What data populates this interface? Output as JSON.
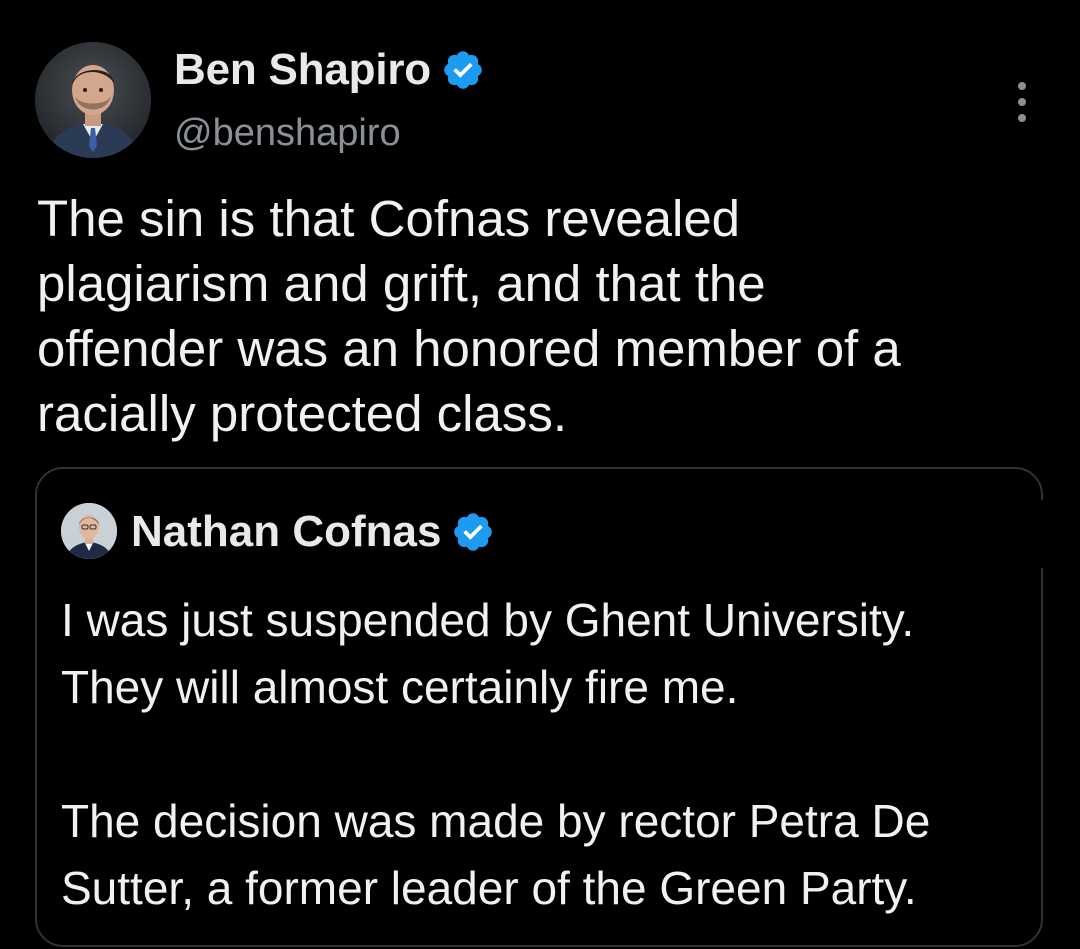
{
  "tweet": {
    "author_name": "Ben Shapiro",
    "author_handle": "@benshapiro",
    "verified": true,
    "text_lines": [
      "The sin is that Cofnas revealed",
      "plagiarism and grift, and that the",
      "offender was an honored member of a",
      "racially protected class."
    ]
  },
  "quoted_tweet": {
    "author_name": "Nathan Cofnas",
    "verified": true,
    "paragraph1_lines": [
      "I was just suspended by Ghent University.",
      "They will almost certainly fire me."
    ],
    "paragraph2_lines": [
      "The decision was made by rector Petra De",
      "Sutter, a former leader of the Green Party."
    ]
  },
  "colors": {
    "background": "#000000",
    "text_primary": "#e7e9ea",
    "text_secondary": "#8b9096",
    "verified_blue": "#1d9bf0",
    "card_border": "#2f3336"
  },
  "icons": {
    "verified": "verified-badge-icon",
    "more": "more-vertical-icon"
  }
}
